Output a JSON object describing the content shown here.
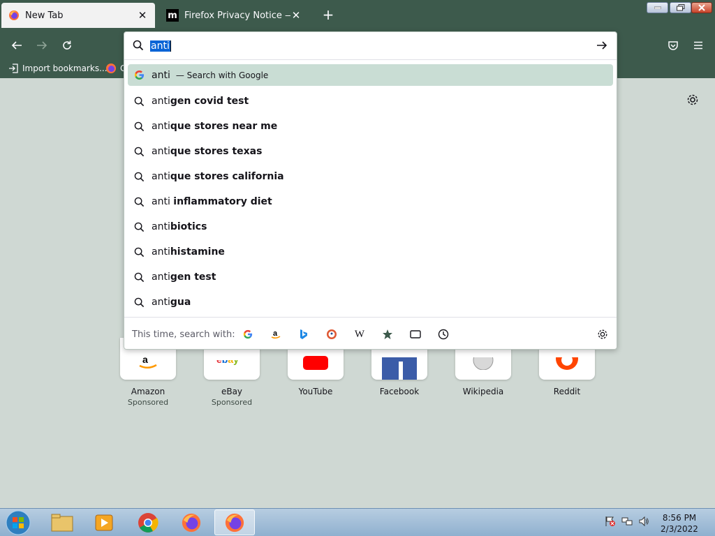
{
  "tabs": [
    {
      "label": "New Tab",
      "favicon": "firefox-icon",
      "active": true
    },
    {
      "label": "Firefox Privacy Notice — Mozilla",
      "favicon": "mozilla-m-icon",
      "active": false
    }
  ],
  "bookmarks": [
    {
      "label": "Import bookmarks...",
      "icon": "import-icon"
    },
    {
      "label": "G",
      "icon": "firefox-icon"
    }
  ],
  "urlbar": {
    "value": "anti"
  },
  "results": [
    {
      "typed": "anti",
      "suffix": "",
      "engine_text": "— Search with Google",
      "icon": "google-icon"
    },
    {
      "typed": "anti",
      "suffix": "gen covid test",
      "icon": "search-icon"
    },
    {
      "typed": "anti",
      "suffix": "que stores near me",
      "icon": "search-icon"
    },
    {
      "typed": "anti",
      "suffix": "que stores texas",
      "icon": "search-icon"
    },
    {
      "typed": "anti",
      "suffix": "que stores california",
      "icon": "search-icon"
    },
    {
      "typed": "anti ",
      "suffix": "inflammatory diet",
      "icon": "search-icon"
    },
    {
      "typed": "anti",
      "suffix": "biotics",
      "icon": "search-icon"
    },
    {
      "typed": "anti",
      "suffix": "histamine",
      "icon": "search-icon"
    },
    {
      "typed": "anti",
      "suffix": "gen test",
      "icon": "search-icon"
    },
    {
      "typed": "anti",
      "suffix": "gua",
      "icon": "search-icon"
    }
  ],
  "oneoff": {
    "label": "This time, search with:",
    "engines": [
      "google-icon",
      "amazon-icon",
      "bing-icon",
      "duckduckgo-icon",
      "wikipedia-icon",
      "bookmarks-star-icon",
      "tabs-icon",
      "history-icon"
    ]
  },
  "tiles": [
    {
      "title": "Amazon",
      "sponsor": "Sponsored"
    },
    {
      "title": "eBay",
      "sponsor": "Sponsored"
    },
    {
      "title": "YouTube",
      "sponsor": ""
    },
    {
      "title": "Facebook",
      "sponsor": ""
    },
    {
      "title": "Wikipedia",
      "sponsor": ""
    },
    {
      "title": "Reddit",
      "sponsor": ""
    }
  ],
  "taskbar": {
    "time": "8:56 PM",
    "date": "2/3/2022"
  },
  "colors": {
    "chrome": "#3d5a4c",
    "content_bg": "#cfd8d3",
    "highlight_row": "#c9ddd4",
    "selection": "#0a64d6"
  }
}
